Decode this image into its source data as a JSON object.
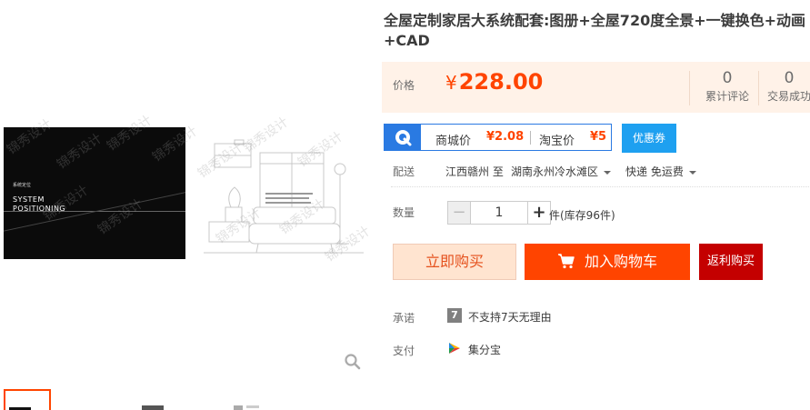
{
  "product": {
    "title": "全屋定制家居大系统配套:图册+全屋720度全景+一键换色+动画+CAD"
  },
  "gallery": {
    "image_text_small": "系统定位",
    "image_text_main": "SYSTEM POSITIONING",
    "watermark": "锦秀设计",
    "zoom_icon": "search-icon"
  },
  "price": {
    "label": "价格",
    "currency": "¥",
    "value": "228.00",
    "reviews_count": "0",
    "reviews_label": "累计评论",
    "sales_count": "0",
    "sales_label": "交易成功"
  },
  "promo": {
    "mall_label": "商城价",
    "mall_value": "¥2.08",
    "taobao_label": "淘宝价",
    "taobao_value": "¥5",
    "coupon_label": "优惠券"
  },
  "shipping": {
    "label": "配送",
    "from": "江西赣州 至",
    "to": "湖南永州冷水滩区",
    "method": "快递 免运费"
  },
  "quantity": {
    "label": "数量",
    "minus": "−",
    "value": "1",
    "plus": "+",
    "stock": "件(库存96件)"
  },
  "actions": {
    "buy_now": "立即购买",
    "add_to_cart": "加入购物车",
    "rebate": "返利购买"
  },
  "promise": {
    "label": "承诺",
    "icon_char": "7",
    "text": "不支持7天无理由"
  },
  "payment": {
    "label": "支付",
    "text": "集分宝"
  },
  "colors": {
    "accent": "#ff4400",
    "price": "#ff4400",
    "price_bg": "#fff2e8",
    "coupon": "#1ea0f0",
    "rebate": "#c40000"
  }
}
